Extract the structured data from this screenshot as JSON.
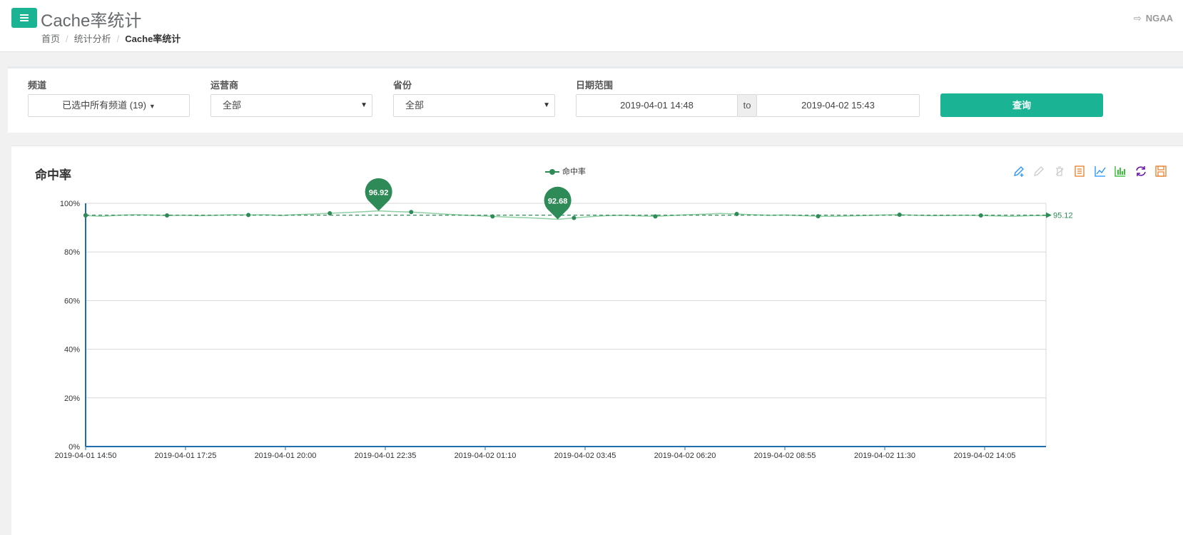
{
  "header": {
    "title": "Cache率统计",
    "breadcrumb": [
      "首页",
      "统计分析",
      "Cache率统计"
    ],
    "user": "NGAA"
  },
  "filters": {
    "channel_label": "频道",
    "channel_value": "已选中所有频道 (19)",
    "operator_label": "运营商",
    "operator_value": "全部",
    "province_label": "省份",
    "province_value": "全部",
    "date_label": "日期范围",
    "date_start": "2019-04-01 14:48",
    "date_to": "to",
    "date_end": "2019-04-02 15:43",
    "query_button": "查询"
  },
  "chart": {
    "title": "命中率",
    "legend": "命中率",
    "colors": {
      "series": "#2e8b57",
      "accent": "#1ab394"
    },
    "toolbox_icons": [
      "mark-icon",
      "mark-undo-icon",
      "mark-clear-icon",
      "data-view-icon",
      "line-chart-icon",
      "bar-chart-icon",
      "restore-icon",
      "save-image-icon"
    ]
  },
  "chart_data": {
    "type": "line",
    "title": "命中率",
    "legend": [
      "命中率"
    ],
    "x_ticks": [
      "2019-04-01 14:50",
      "2019-04-01 17:25",
      "2019-04-01 20:00",
      "2019-04-01 22:35",
      "2019-04-02 01:10",
      "2019-04-02 03:45",
      "2019-04-02 06:20",
      "2019-04-02 08:55",
      "2019-04-02 11:30",
      "2019-04-02 14:05"
    ],
    "y_ticks": [
      "0%",
      "20%",
      "40%",
      "60%",
      "80%",
      "100%"
    ],
    "ylim": [
      0,
      100
    ],
    "grid": true,
    "series": [
      {
        "name": "命中率",
        "values": [
          95.0,
          94.6,
          95.1,
          95.3,
          95.2,
          95.0,
          95.1,
          94.9,
          95.1,
          95.3,
          95.2,
          95.3,
          95.0,
          95.4,
          95.6,
          95.9,
          96.2,
          96.5,
          96.9,
          96.6,
          96.4,
          96.0,
          95.6,
          95.2,
          94.9,
          94.6,
          94.3,
          94.1,
          93.8,
          93.4,
          94.0,
          94.5,
          94.9,
          95.1,
          94.8,
          94.6,
          95.0,
          95.3,
          95.5,
          95.8,
          95.6,
          95.3,
          95.1,
          95.2,
          94.9,
          94.7,
          94.6,
          94.8,
          95.0,
          95.2,
          95.3,
          95.1,
          94.9,
          95.0,
          95.1,
          95.0,
          94.8,
          94.6,
          94.9,
          95.0
        ]
      }
    ],
    "max_label": "96.92",
    "min_label": "92.68",
    "average_label": "95.12"
  }
}
